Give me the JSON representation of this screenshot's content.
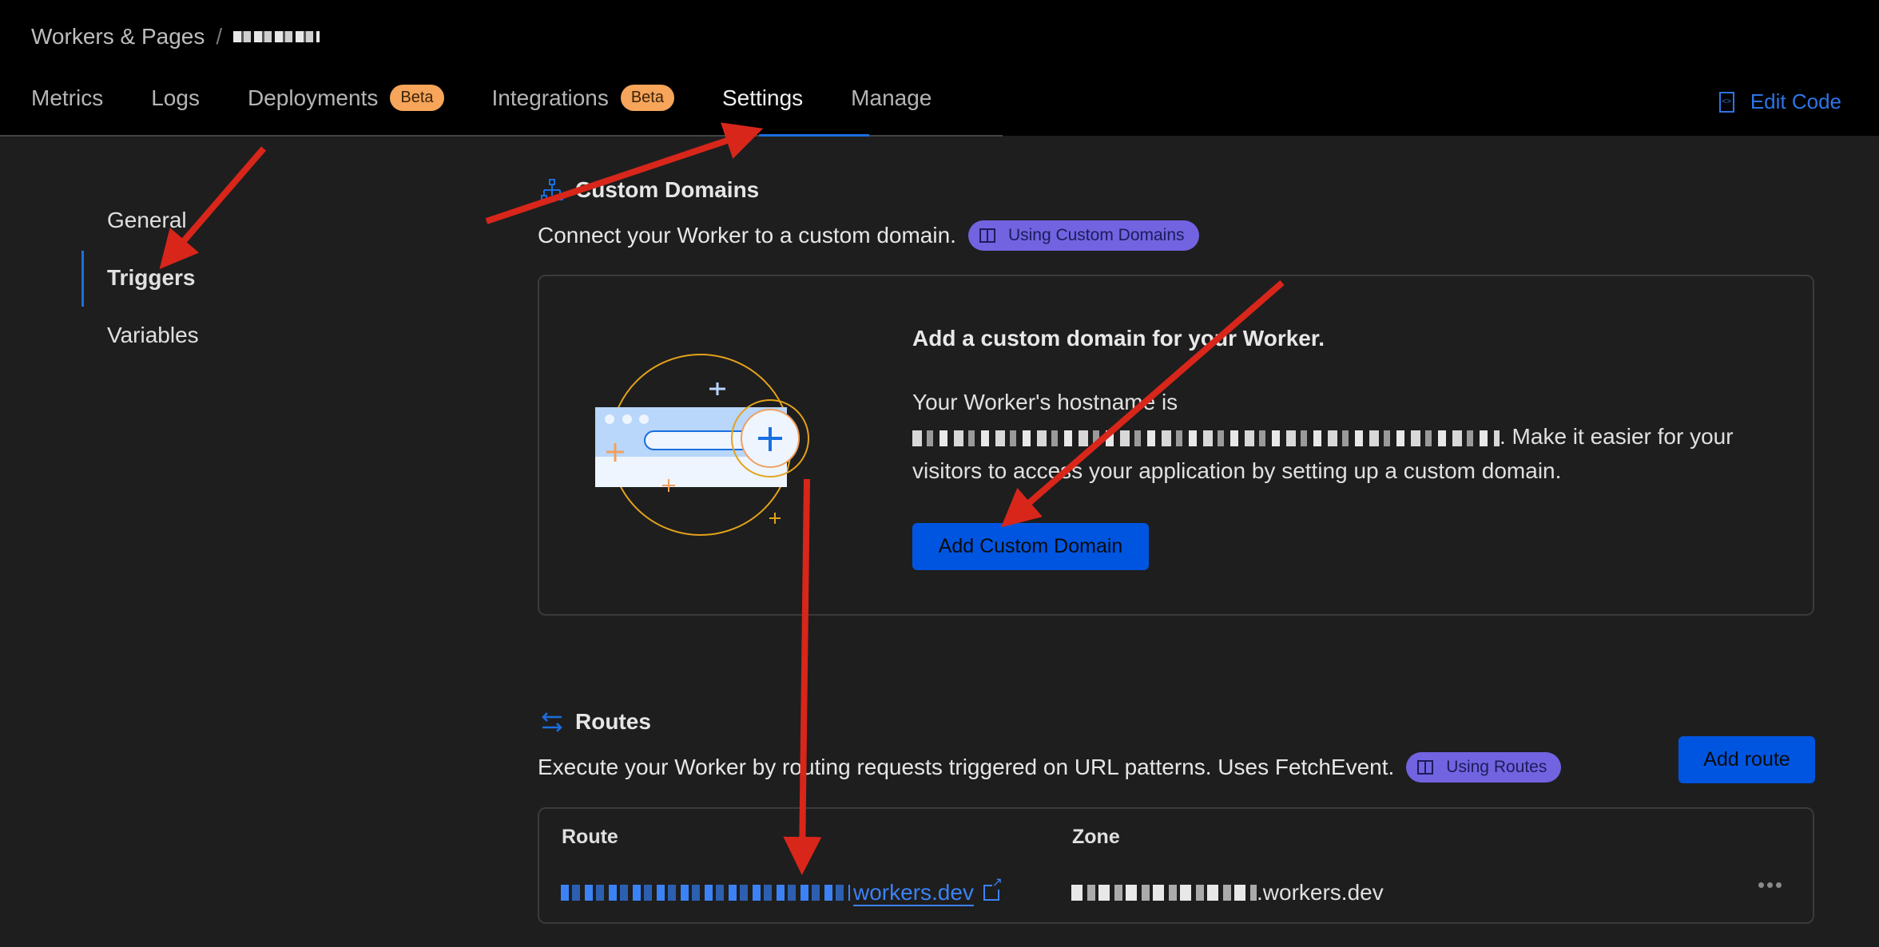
{
  "header": {
    "breadcrumb": {
      "root": "Workers & Pages",
      "separator": "/",
      "current": "[redacted]"
    },
    "tabs": [
      {
        "label": "Metrics",
        "active": false
      },
      {
        "label": "Logs",
        "active": false
      },
      {
        "label": "Deployments",
        "badge": "Beta",
        "active": false
      },
      {
        "label": "Integrations",
        "badge": "Beta",
        "active": false
      },
      {
        "label": "Settings",
        "active": true
      },
      {
        "label": "Manage",
        "active": false
      }
    ],
    "edit_code_label": "Edit Code",
    "edit_code_icon": "code-file-icon"
  },
  "sidenav": {
    "items": [
      {
        "label": "General",
        "active": false
      },
      {
        "label": "Triggers",
        "active": true
      },
      {
        "label": "Variables",
        "active": false
      }
    ]
  },
  "custom_domains": {
    "icon": "sitemap-icon",
    "title": "Custom Domains",
    "description": "Connect your Worker to a custom domain.",
    "doc_link": "Using Custom Domains",
    "card": {
      "heading": "Add a custom domain for your Worker.",
      "hostname_intro": "Your Worker's hostname is",
      "hostname": "[redacted].workers.dev",
      "hostname_suffix": ". Make it easier for your visitors to access your application by setting up a custom domain.",
      "button_label": "Add Custom Domain"
    }
  },
  "routes": {
    "icon": "arrows-swap-icon",
    "title": "Routes",
    "description": "Execute your Worker by routing requests triggered on URL patterns. Uses FetchEvent.",
    "doc_link": "Using Routes",
    "add_button_label": "Add route",
    "columns": [
      "Route",
      "Zone"
    ],
    "rows": [
      {
        "route_prefix": "[redacted].",
        "route_domain": "workers.dev",
        "zone_prefix": "[redacted]",
        "zone_domain": ".workers.dev"
      }
    ]
  },
  "colors": {
    "accent_blue": "#0055e0",
    "link_blue": "#3b82f6",
    "beta_badge": "#f6a55a",
    "doc_badge": "#7263e0",
    "annotation_red": "#d8261a"
  }
}
